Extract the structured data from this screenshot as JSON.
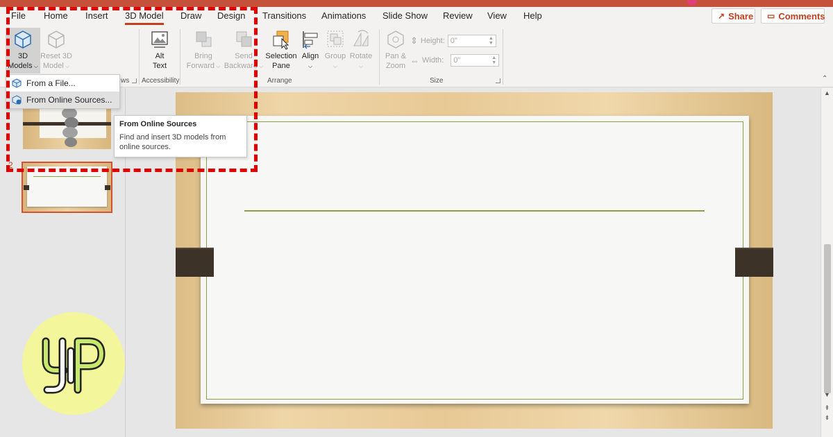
{
  "menu": {
    "tabs": [
      "File",
      "Home",
      "Insert",
      "3D Model",
      "Draw",
      "Design",
      "Transitions",
      "Animations",
      "Slide Show",
      "Review",
      "View",
      "Help"
    ],
    "active_tab": "3D Model",
    "share_label": "Share",
    "comments_label": "Comments"
  },
  "ribbon": {
    "models_line1": "3D",
    "models_line2": "Models",
    "reset_line1": "Reset 3D",
    "reset_line2": "Model",
    "views_group_partial": "ws",
    "alt_line1": "Alt",
    "alt_line2": "Text",
    "accessibility_group": "Accessibility",
    "bring_line1": "Bring",
    "bring_line2": "Forward",
    "send_line1": "Send",
    "send_line2": "Backward",
    "selection_line1": "Selection",
    "selection_line2": "Pane",
    "align_label": "Align",
    "group_label": "Group",
    "rotate_label": "Rotate",
    "arrange_group": "Arrange",
    "pan_line1": "Pan &",
    "pan_line2": "Zoom",
    "height_label": "Height:",
    "height_value": "0\"",
    "width_label": "Width:",
    "width_value": "0\"",
    "size_group": "Size"
  },
  "dropdown": {
    "from_file": "From a File...",
    "from_online": "From Online Sources..."
  },
  "tooltip": {
    "title": "From Online Sources",
    "body_line1": "Find and insert 3D models from",
    "body_line2": "online sources."
  },
  "slides_pane": {
    "slide2_number": "2"
  },
  "colors": {
    "accent": "#c43e1c",
    "highlight": "#e00000",
    "slide_line": "#8aa046",
    "logo_bg": "#f3f69a"
  }
}
